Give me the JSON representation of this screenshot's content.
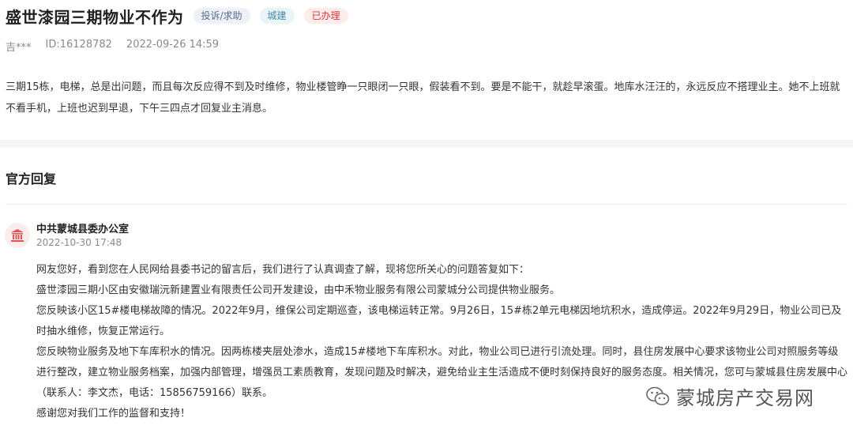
{
  "header": {
    "title": "盛世漆园三期物业不作为",
    "tags": [
      "投诉/求助",
      "城建",
      "已办理"
    ]
  },
  "meta": {
    "author": "吉***",
    "id": "ID:16128782",
    "time": "2022-09-26 14:59"
  },
  "complaint": {
    "text": "三期15栋，电梯，总是出问题，而且每次反应得不到及时维修，物业楼管睁一只眼闭一只眼，假装看不到。要是不能干，就趁早滚蛋。地库水汪汪的，永远反应不搭理业主。她不上班就不看手机，上班也迟到早退，下午三四点才回复业主消息。"
  },
  "reply_section": {
    "title": "官方回复",
    "org_name": "中共蒙城县委办公室",
    "time": "2022-10-30 17:48",
    "paragraphs": [
      "网友您好，看到您在人民网给县委书记的留言后，我们进行了认真调查了解，现将您所关心的问题答复如下：",
      "盛世漆园三期小区由安徽瑞沅新建置业有限责任公司开发建设，由中禾物业服务有限公司蒙城分公司提供物业服务。",
      "您反映该小区15#楼电梯故障的情况。2022年9月，维保公司定期巡查，该电梯运转正常。9月26日，15#栋2单元电梯因地坑积水，造成停运。2022年9月29日，物业公司已及时抽水维修，恢复正常运行。",
      "您反映物业服务及地下车库积水的情况。因两栋楼夹层处渗水，造成15#楼地下车库积水。对此，物业公司已进行引流处理。同时，县住房发展中心要求该物业公司对照服务等级进行整改，建立物业服务档案，加强内部管理，增强员工素质教育，发现问题及时解决，避免给业主生活造成不便时刻保持良好的服务态度。相关情况，您可与蒙城县住房发展中心（联系人：李文杰，电话：15856759166）联系。",
      "感谢您对我们工作的监督和支持！"
    ]
  },
  "watermark": {
    "text": "蒙城房产交易网",
    "icon": "wechat-icon"
  },
  "colors": {
    "tag_red": "#d9363e",
    "band": "#f5f6f8"
  }
}
